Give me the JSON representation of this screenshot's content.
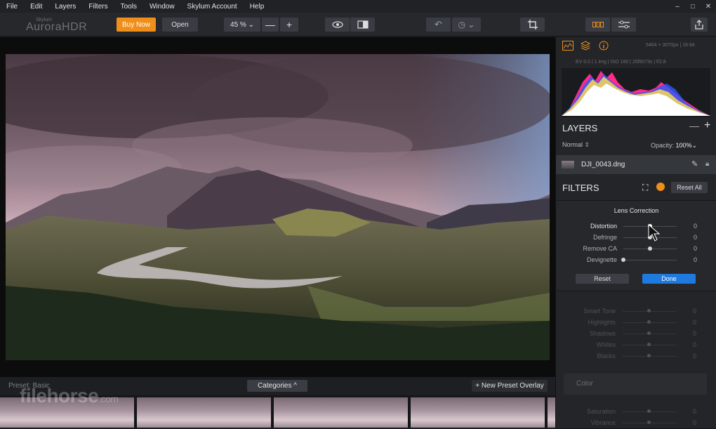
{
  "menu": [
    "File",
    "Edit",
    "Layers",
    "Filters",
    "Tools",
    "Window",
    "Skylum Account",
    "Help"
  ],
  "window_controls": {
    "minimize": "–",
    "maximize": "□",
    "close": "✕"
  },
  "app": {
    "logo_top": "Skylum",
    "logo_main": "AuroraHDR"
  },
  "toolbar": {
    "buy_now": "Buy Now",
    "open": "Open",
    "zoom": "45 % ⌄",
    "zoom_out": "—",
    "zoom_in": "+",
    "undo": "↶",
    "history": "◷ ⌄",
    "crop": "⌗"
  },
  "panel": {
    "image_info": "5464 × 3070px | 16-bit",
    "exif": "EV 0.0    |   1 img   |  ISO 160  |  20l5073s  |   f/2.8",
    "layers_title": "LAYERS",
    "layers_minus": "—",
    "layers_plus": "+",
    "blend_mode": "Normal ⇳",
    "opacity_label": "Opacity:",
    "opacity_value": "100%⌄",
    "layer_name": "DJI_0043.dng",
    "filters_title": "FILTERS",
    "reset_all": "Reset All"
  },
  "lens_correction": {
    "title": "Lens Correction",
    "sliders": [
      {
        "label": "Distortion",
        "value": "0",
        "position": 0.5
      },
      {
        "label": "Defringe",
        "value": "0",
        "position": 0.5
      },
      {
        "label": "Remove CA",
        "value": "0",
        "position": 0.5
      },
      {
        "label": "Devignette",
        "value": "0",
        "position": 0.0
      }
    ],
    "reset": "Reset",
    "done": "Done"
  },
  "dim_sliders": [
    {
      "label": "Smart Tone",
      "value": "0"
    },
    {
      "label": "Highlights",
      "value": "0"
    },
    {
      "label": "Shadows",
      "value": "0"
    },
    {
      "label": "Whites",
      "value": "0"
    },
    {
      "label": "Blacks",
      "value": "0"
    }
  ],
  "color_section": {
    "title": "Color"
  },
  "dim_bottom": [
    {
      "label": "Saturation",
      "value": "0"
    },
    {
      "label": "Vibrance",
      "value": "0"
    }
  ],
  "presets": {
    "label": "Preset: Basic",
    "categories": "Categories ^",
    "new_overlay": "+ New Preset Overlay"
  },
  "watermark": {
    "main": "filehorse",
    "suffix": ".com"
  },
  "colors": {
    "accent": "#ef8f1a",
    "done_blue": "#1f7ae0"
  }
}
